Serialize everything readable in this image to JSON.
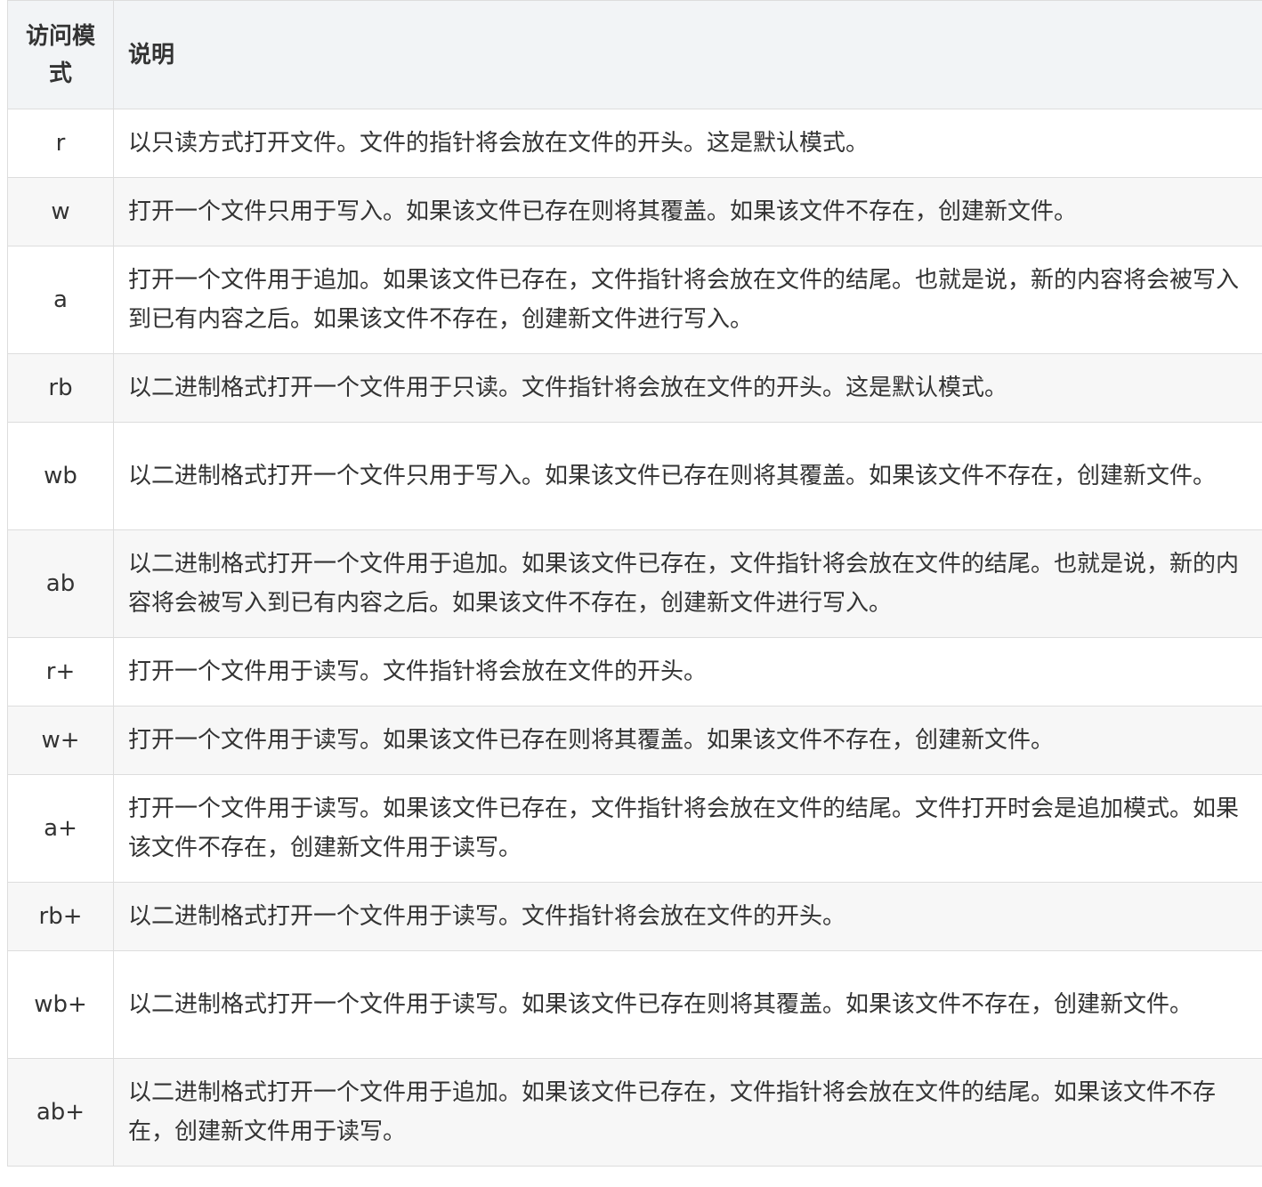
{
  "table": {
    "headers": {
      "mode": "访问模式",
      "desc": "说明"
    },
    "rows": [
      {
        "mode": "r",
        "desc": "以只读方式打开文件。文件的指针将会放在文件的开头。这是默认模式。"
      },
      {
        "mode": "w",
        "desc": "打开一个文件只用于写入。如果该文件已存在则将其覆盖。如果该文件不存在，创建新文件。"
      },
      {
        "mode": "a",
        "desc": "打开一个文件用于追加。如果该文件已存在，文件指针将会放在文件的结尾。也就是说，新的内容将会被写入到已有内容之后。如果该文件不存在，创建新文件进行写入。"
      },
      {
        "mode": "rb",
        "desc": "以二进制格式打开一个文件用于只读。文件指针将会放在文件的开头。这是默认模式。"
      },
      {
        "mode": "wb",
        "desc": "以二进制格式打开一个文件只用于写入。如果该文件已存在则将其覆盖。如果该文件不存在，创建新文件。"
      },
      {
        "mode": "ab",
        "desc": "以二进制格式打开一个文件用于追加。如果该文件已存在，文件指针将会放在文件的结尾。也就是说，新的内容将会被写入到已有内容之后。如果该文件不存在，创建新文件进行写入。"
      },
      {
        "mode": "r+",
        "desc": "打开一个文件用于读写。文件指针将会放在文件的开头。"
      },
      {
        "mode": "w+",
        "desc": "打开一个文件用于读写。如果该文件已存在则将其覆盖。如果该文件不存在，创建新文件。"
      },
      {
        "mode": "a+",
        "desc": "打开一个文件用于读写。如果该文件已存在，文件指针将会放在文件的结尾。文件打开时会是追加模式。如果该文件不存在，创建新文件用于读写。"
      },
      {
        "mode": "rb+",
        "desc": "以二进制格式打开一个文件用于读写。文件指针将会放在文件的开头。"
      },
      {
        "mode": "wb+",
        "desc": "以二进制格式打开一个文件用于读写。如果该文件已存在则将其覆盖。如果该文件不存在，创建新文件。"
      },
      {
        "mode": "ab+",
        "desc": "以二进制格式打开一个文件用于追加。如果该文件已存在，文件指针将会放在文件的结尾。如果该文件不存在，创建新文件用于读写。"
      }
    ]
  }
}
